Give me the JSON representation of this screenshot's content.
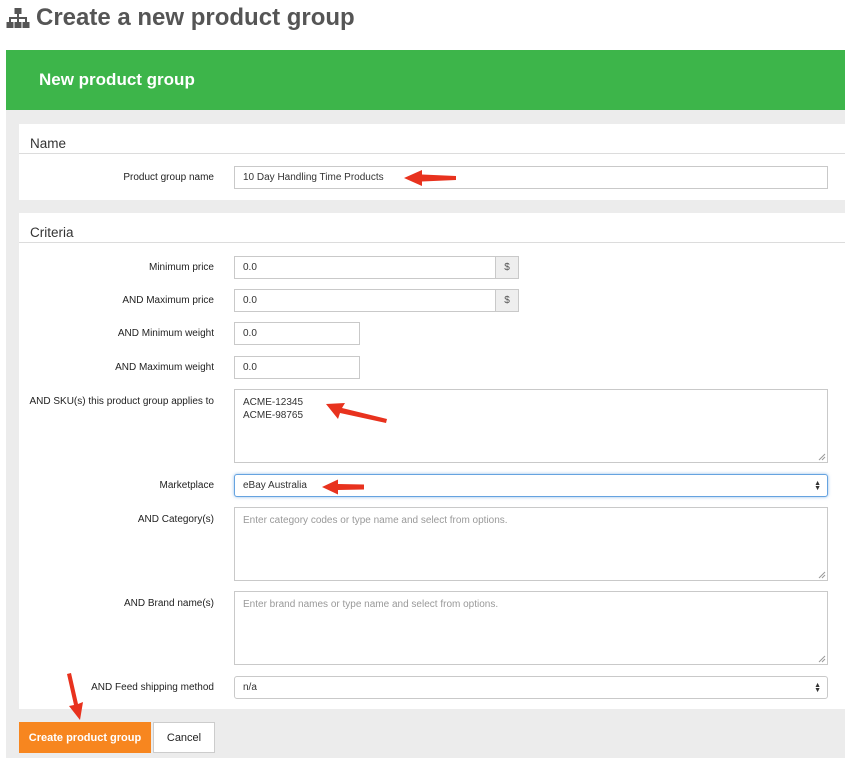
{
  "page": {
    "title": "Create a new product group",
    "icon": "sitemap-icon"
  },
  "panel": {
    "heading": "New product group",
    "accent_color": "#3db54a"
  },
  "name_section": {
    "title": "Name",
    "product_group_name": {
      "label": "Product group name",
      "value": "10 Day Handling Time Products"
    }
  },
  "criteria": {
    "title": "Criteria",
    "min_price": {
      "label": "Minimum price",
      "value": "0.0",
      "addon": "$"
    },
    "max_price": {
      "label": "AND Maximum price",
      "value": "0.0",
      "addon": "$"
    },
    "min_weight": {
      "label": "AND Minimum weight",
      "value": "0.0"
    },
    "max_weight": {
      "label": "AND Maximum weight",
      "value": "0.0"
    },
    "skus": {
      "label": "AND SKU(s) this product group applies to",
      "lines": [
        "ACME-12345",
        "ACME-98765"
      ]
    },
    "marketplace": {
      "label": "Marketplace",
      "value": "eBay Australia"
    },
    "categories": {
      "label": "AND Category(s)",
      "placeholder": "Enter category codes or type name and select from options."
    },
    "brands": {
      "label": "AND Brand name(s)",
      "placeholder": "Enter brand names or type name and select from options."
    },
    "feed_shipping": {
      "label": "AND Feed shipping method",
      "value": "n/a"
    }
  },
  "actions": {
    "create_label": "Create product group",
    "cancel_label": "Cancel",
    "create_color": "#f7861f"
  },
  "annotation_arrow_color": "#e8321e"
}
